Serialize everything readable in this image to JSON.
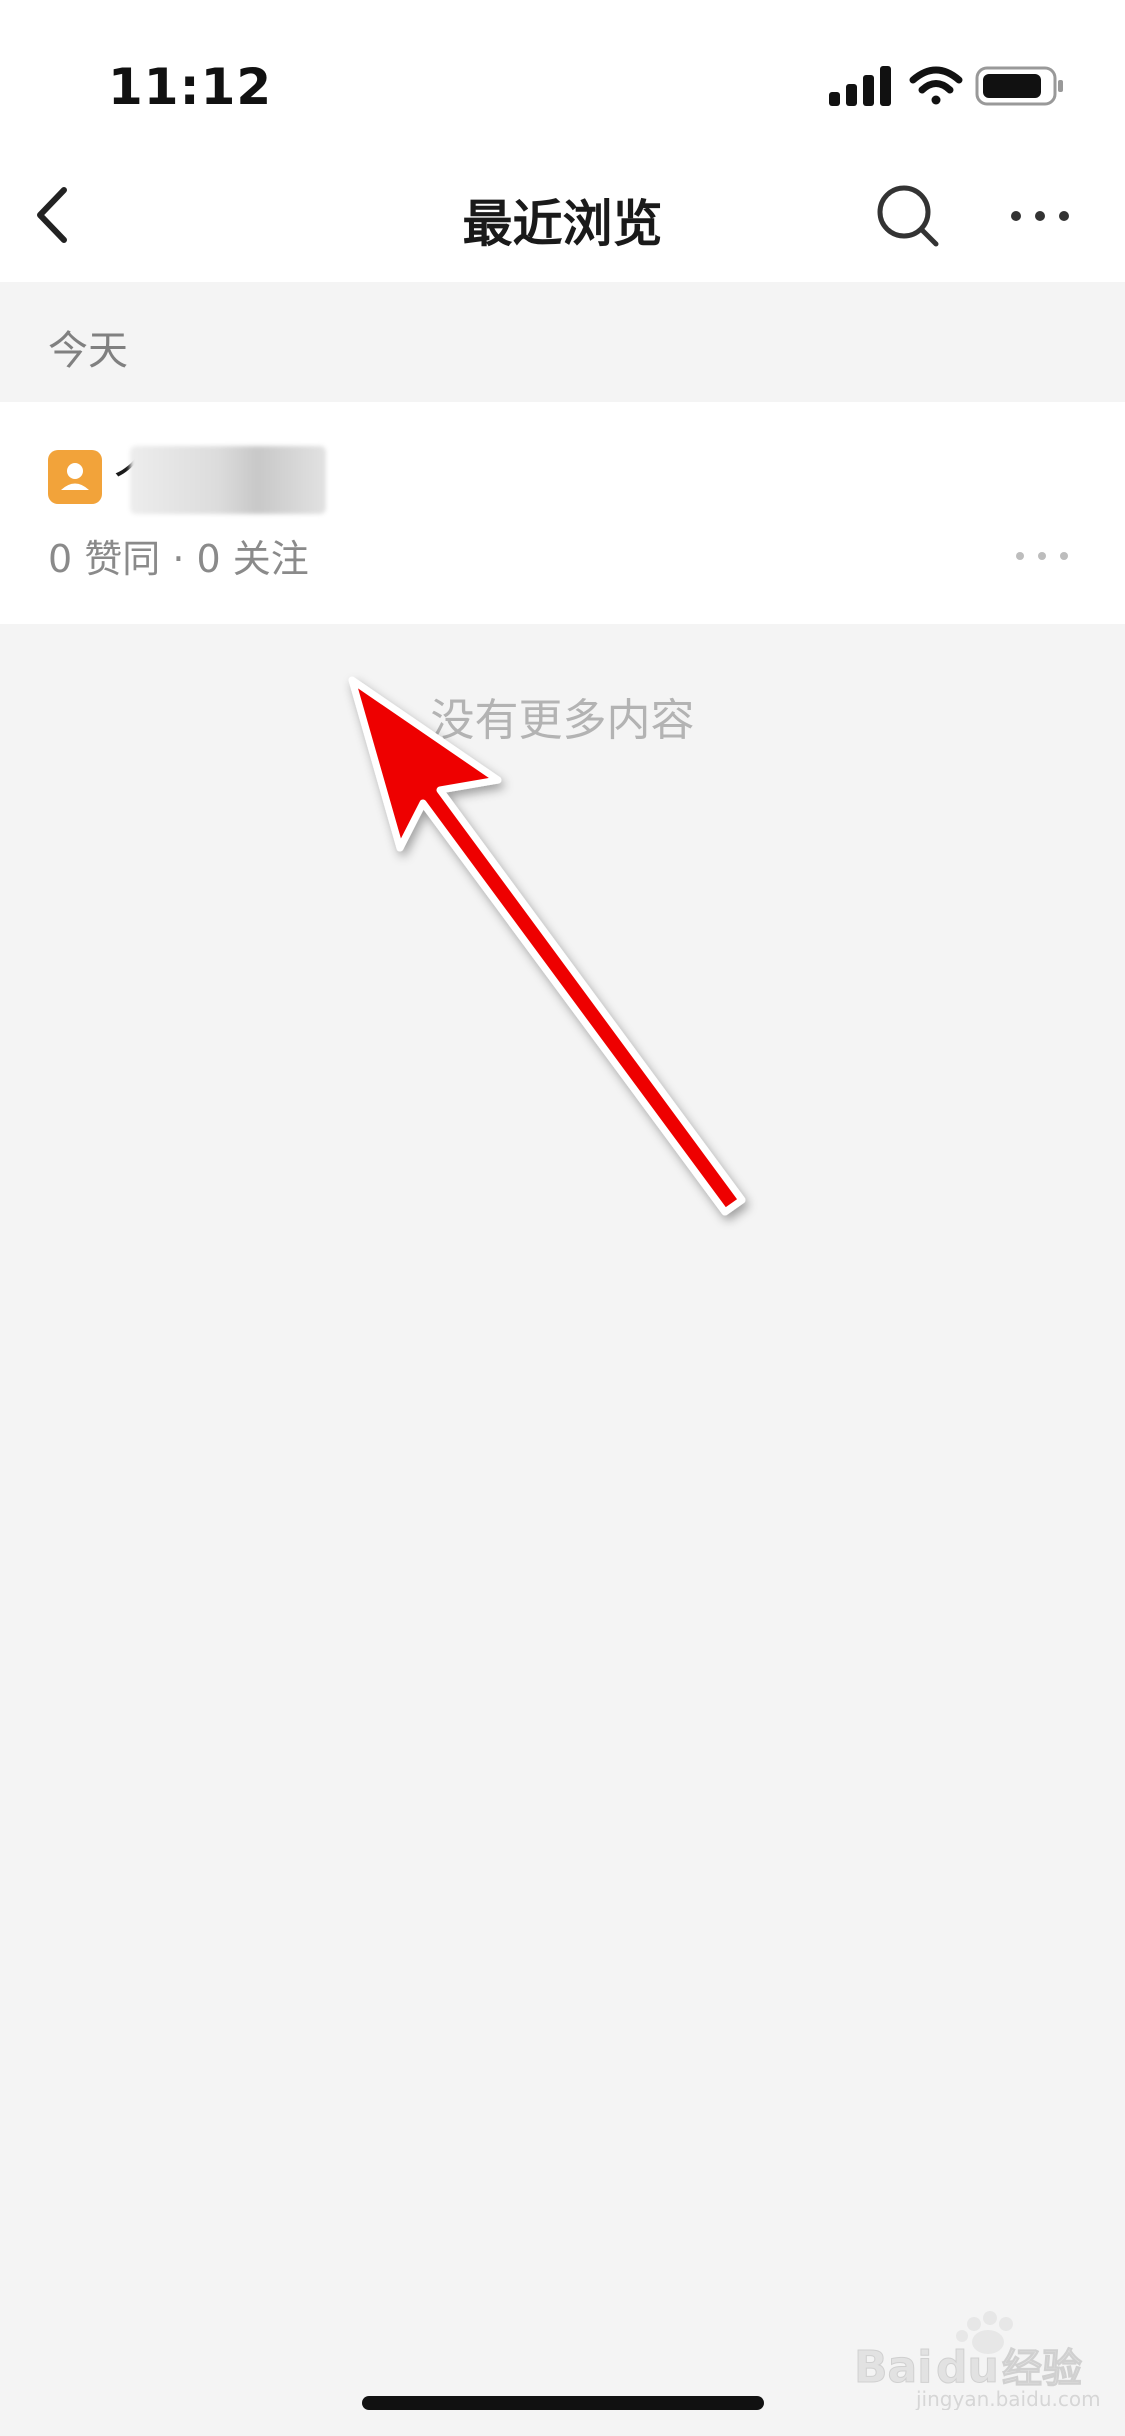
{
  "status_bar": {
    "time": "11:12",
    "icons": [
      "cellular-signal-icon",
      "wifi-icon",
      "battery-icon"
    ]
  },
  "nav": {
    "title": "最近浏览",
    "back_icon": "chevron-left-icon",
    "search_icon": "search-icon",
    "more_icon": "ellipsis-icon"
  },
  "section": {
    "label": "今天"
  },
  "items": [
    {
      "title": "个",
      "meta": "0 赞同 · 0 关注",
      "avatar_color": "#f2a33a"
    }
  ],
  "end_message": "没有更多内容",
  "watermark": {
    "brand": "Bai",
    "brand_mid": "du",
    "suffix": "经验",
    "url": "jingyan.baidu.com"
  },
  "colors": {
    "background": "#f4f4f4",
    "card": "#ffffff",
    "annotation_arrow": "#ee0000",
    "avatar": "#f2a33a"
  }
}
